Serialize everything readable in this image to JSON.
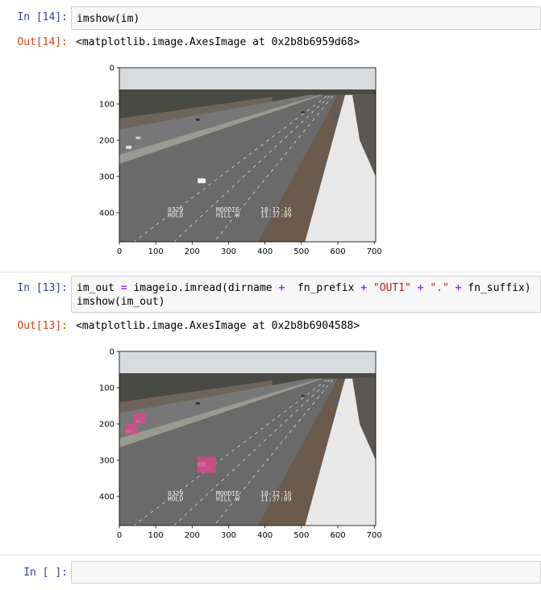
{
  "cells": [
    {
      "input_prompt": "In [14]:",
      "code_lines": [
        "imshow(im)"
      ],
      "output_prompt": "Out[14]:",
      "output_text": "<matplotlib.image.AxesImage at 0x2b8b6959d68>",
      "image": {
        "description": "highway traffic camera frame",
        "overlay_boxes": []
      }
    },
    {
      "input_prompt": "In [13]:",
      "code_lines": [
        "im_out = imageio.imread(dirname +  fn_prefix + \"OUT1\" + \".\" + fn_suffix)",
        "imshow(im_out)"
      ],
      "output_prompt": "Out[13]:",
      "output_text": "<matplotlib.image.AxesImage at 0x2b8b6904588>",
      "image": {
        "description": "highway traffic camera frame with detection overlays",
        "overlay_boxes": [
          {
            "color": "#d44b8c"
          },
          {
            "color": "#d44b8c"
          },
          {
            "color": "#d44b8c"
          }
        ]
      }
    }
  ],
  "empty_cell": {
    "input_prompt": "In [ ]:",
    "placeholder": ""
  },
  "axes": {
    "x_ticks": [
      "0",
      "100",
      "200",
      "300",
      "400",
      "500",
      "600",
      "700"
    ],
    "y_ticks": [
      "0",
      "100",
      "200",
      "300",
      "400"
    ]
  },
  "camera_overlay_text": {
    "line1_left": "0329",
    "line2_left": "HOLD",
    "line1_mid": "MOODIE",
    "line2_mid": "HILL W",
    "line1_right": "18-12-16",
    "line2_right": "11:37:09"
  },
  "colors": {
    "in_prompt": "#303f9f",
    "out_prompt": "#d84315",
    "overlay_box": "#d44b8c"
  }
}
